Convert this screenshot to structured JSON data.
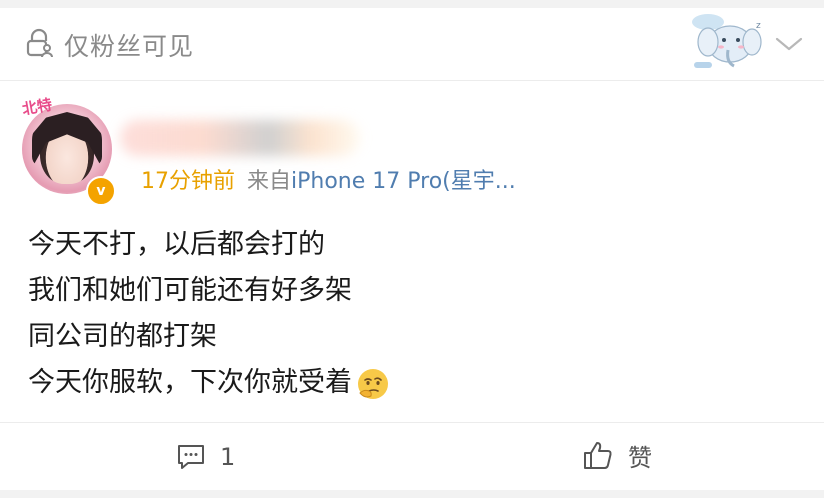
{
  "header": {
    "visibility_icon": "lock-person-icon",
    "visibility_label": "仅粉丝可见",
    "sticker_icon": "cartoon-elephant-sticker",
    "menu_icon": "chevron-down-icon"
  },
  "author": {
    "avatar_icon": "avatar",
    "avatar_text": "北特",
    "verified_icon": "verified-badge-icon",
    "verified_mark": "v",
    "name_blurred": true
  },
  "meta": {
    "time": "17分钟前",
    "source_prefix": "来自",
    "device": "iPhone 17 Pro(星宇..."
  },
  "post": {
    "lines": [
      "今天不打，以后都会打的",
      "我们和她们可能还有好多架",
      "同公司的都打架",
      "今天你服软，下次你就受着"
    ],
    "emoji_icon": "thinking-face-emoji"
  },
  "actions": {
    "comment_icon": "comment-icon",
    "comment_count": "1",
    "like_icon": "thumbs-up-icon",
    "like_label": "赞"
  },
  "colors": {
    "time": "#e8a100",
    "link": "#507daf",
    "muted": "#8a8a8a",
    "verified": "#f4a300"
  }
}
